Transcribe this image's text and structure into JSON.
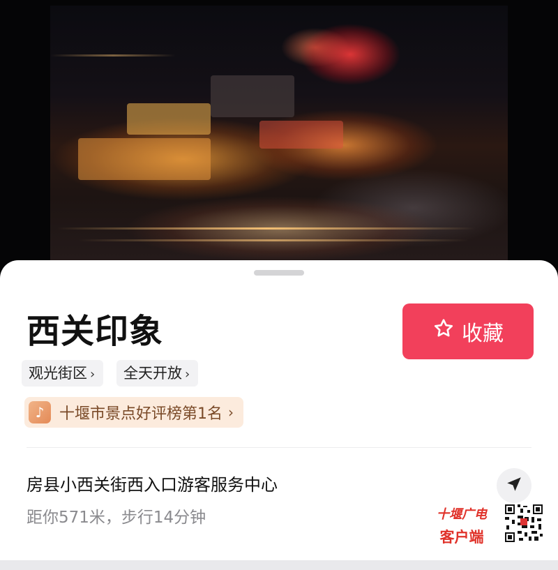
{
  "place": {
    "name": "西关印象",
    "tags": [
      {
        "label": "观光街区"
      },
      {
        "label": "全天开放"
      }
    ],
    "ranking": "十堰市景点好评榜第1名",
    "address": "房县小西关街西入口游客服务中心",
    "distance": "距你571米，步行14分钟"
  },
  "actions": {
    "favorite_label": "收藏"
  },
  "watermark": {
    "line1": "十堰广电",
    "line2": "客户端"
  },
  "colors": {
    "accent": "#f2405b",
    "ranking_bg": "#fcebdd",
    "ranking_text": "#7a4a28",
    "watermark": "#e0322a"
  },
  "icons": {
    "favorite": "star-icon",
    "ranking": "douyin-logo-icon",
    "navigate": "navigation-arrow-icon",
    "chevron": "chevron-right-icon"
  }
}
